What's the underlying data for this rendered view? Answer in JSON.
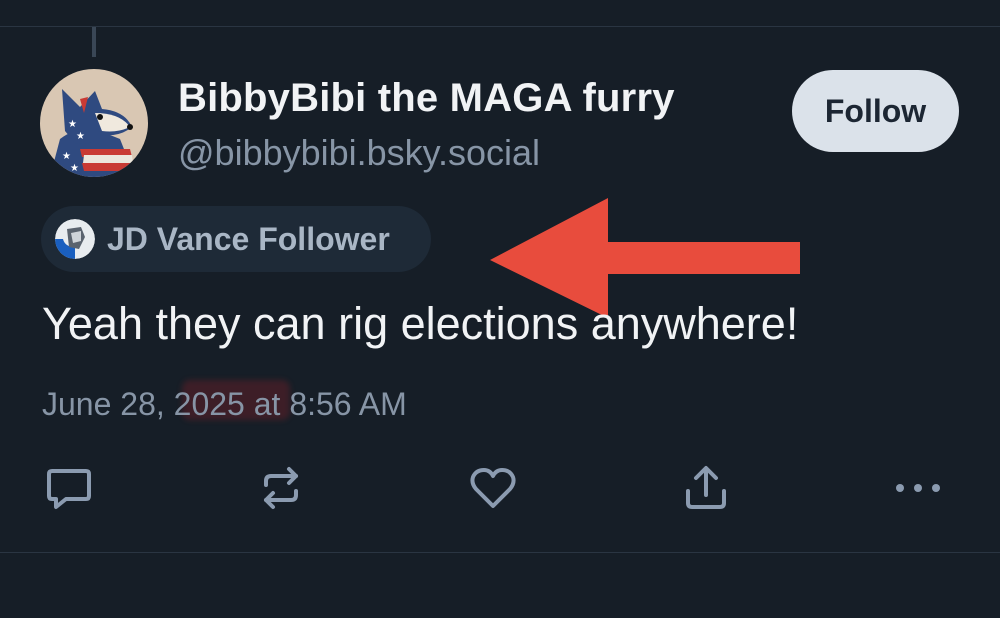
{
  "post": {
    "display_name": "BibbyBibi the MAGA furry",
    "handle": "@bibbybibi.bsky.social",
    "follow_label": "Follow",
    "label_badge": "JD Vance Follower",
    "text": "Yeah they can rig elections anywhere!",
    "timestamp": "June 28, 2025 at 8:56 AM"
  },
  "actions": {
    "reply_icon": "speech-bubble-icon",
    "repost_icon": "repost-arrows-icon",
    "like_icon": "heart-outline-icon",
    "share_icon": "share-upload-icon",
    "more_icon": "ellipsis-icon"
  },
  "colors": {
    "background": "#161e27",
    "text_primary": "#f1f3f5",
    "text_secondary": "#8795a6",
    "follow_bg": "#dbe2ea",
    "arrow": "#e84c3d"
  }
}
